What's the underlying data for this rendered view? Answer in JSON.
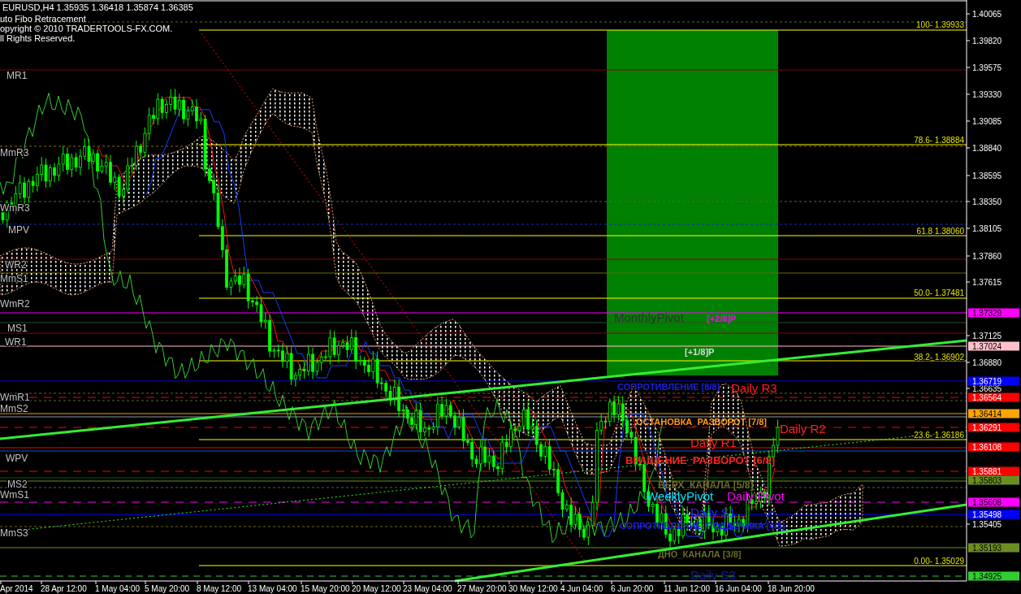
{
  "chart": {
    "symbol_header": "EURUSD,H4  1.35935 1.36418 1.35874 1.36385",
    "indicator_texts": [
      "uto Fibo Retracement",
      "opyright © 2010 TRADERTOOLS-FX.COM.",
      "ll Rights Reserved."
    ]
  },
  "level_labels": [
    "MR1",
    "MmR3",
    "WmR3",
    "MPV",
    "WR2",
    "MmS1",
    "WmR2",
    "MS1",
    "WR1",
    "WmR1",
    "MmS2",
    "WPV",
    "MS2",
    "WmS1",
    "MmS3"
  ],
  "fibo_labels": [
    "100- 1.39933",
    "78.6- 1.38884",
    "61.8 1.38060",
    "50.0- 1.37481",
    "38.2- 1.36902",
    "-23.6- 1.36186",
    "0.00- 1.35029"
  ],
  "chart_labels": [
    {
      "text": "MonthlyPivot",
      "color": "#303030"
    },
    {
      "text": "[+2/8]P",
      "color": "#ff00ff"
    },
    {
      "text": "[+1/8]P",
      "color": "#d8d8d8"
    },
    {
      "text": "СОПРОТИВЛЕНИЕ [8/8]",
      "color": "#1e1ee6"
    },
    {
      "text": "Daily R3",
      "color": "#ff2020"
    },
    {
      "text": "ОСТАНОВКА_РАЗВОРОТ [7/8]",
      "color": "#ff9a1a"
    },
    {
      "text": "Daily R2",
      "color": "#ff2020"
    },
    {
      "text": "Daily R1",
      "color": "#ff2020"
    },
    {
      "text": "ВРАЩЕНИЕ_РАЗВОРОТ [6/8]",
      "color": "#ff2020"
    },
    {
      "text": "ВЕРХ_КАНАЛА [5/8]",
      "color": "#6b6b2a"
    },
    {
      "text": "WeeklyPivot",
      "color": "#00e5ff"
    },
    {
      "text": "Daily Pivot",
      "color": "#ff00ff"
    },
    {
      "text": "Daily S1",
      "color": "#2a2aff"
    },
    {
      "text": "СОПРОТИВЛЕНИЕ_ПОДДЕРЖКА [4/8]",
      "color": "#1e1ee6"
    },
    {
      "text": "ДНО_КАНАЛА [3/8]",
      "color": "#6b6b2a"
    },
    {
      "text": "Daily S3",
      "color": "#1a1aa0"
    }
  ],
  "price_axis": {
    "ticks": [
      "1.40065",
      "1.39820",
      "1.39575",
      "1.39330",
      "1.39085",
      "1.38840",
      "1.38595",
      "1.38350",
      "1.38105",
      "1.37860",
      "1.37615",
      "1.37125",
      "1.36880",
      "1.36635",
      "1.35405"
    ],
    "price_tags": [
      {
        "text": "1.37329",
        "color": "#ff00ff"
      },
      {
        "text": "1.37024",
        "color": "#ffc0cb"
      },
      {
        "text": "1.36719",
        "color": "#0000ff"
      },
      {
        "text": "1.36564",
        "color": "#ff0000"
      },
      {
        "text": "1.36414",
        "color": "#ffa500"
      },
      {
        "text": "1.36291",
        "color": "#ff0000"
      },
      {
        "text": "1.36108",
        "color": "#ff0000"
      },
      {
        "text": "1.35881",
        "color": "#ff0000"
      },
      {
        "text": "1.35803",
        "color": "#6b8e23"
      },
      {
        "text": "1.35608",
        "color": "#ff00ff"
      },
      {
        "text": "1.35498",
        "color": "#0000ff"
      },
      {
        "text": "1.35193",
        "color": "#6b8e23"
      },
      {
        "text": "1.34925",
        "color": "#32cd32"
      }
    ]
  },
  "time_axis": {
    "ticks": [
      "Apr 2014",
      "28 Apr 12:00",
      "1 May 04:00",
      "5 May 20:00",
      "8 May 12:00",
      "13 May 04:00",
      "15 May 20:00",
      "20 May 12:00",
      "23 May 04:00",
      "27 May 20:00",
      "30 May 12:00",
      "4 Jun 04:00",
      "6 Jun 20:00",
      "11 Jun 12:00",
      "16 Jun 04:00",
      "18 Jun 20:00"
    ]
  }
}
